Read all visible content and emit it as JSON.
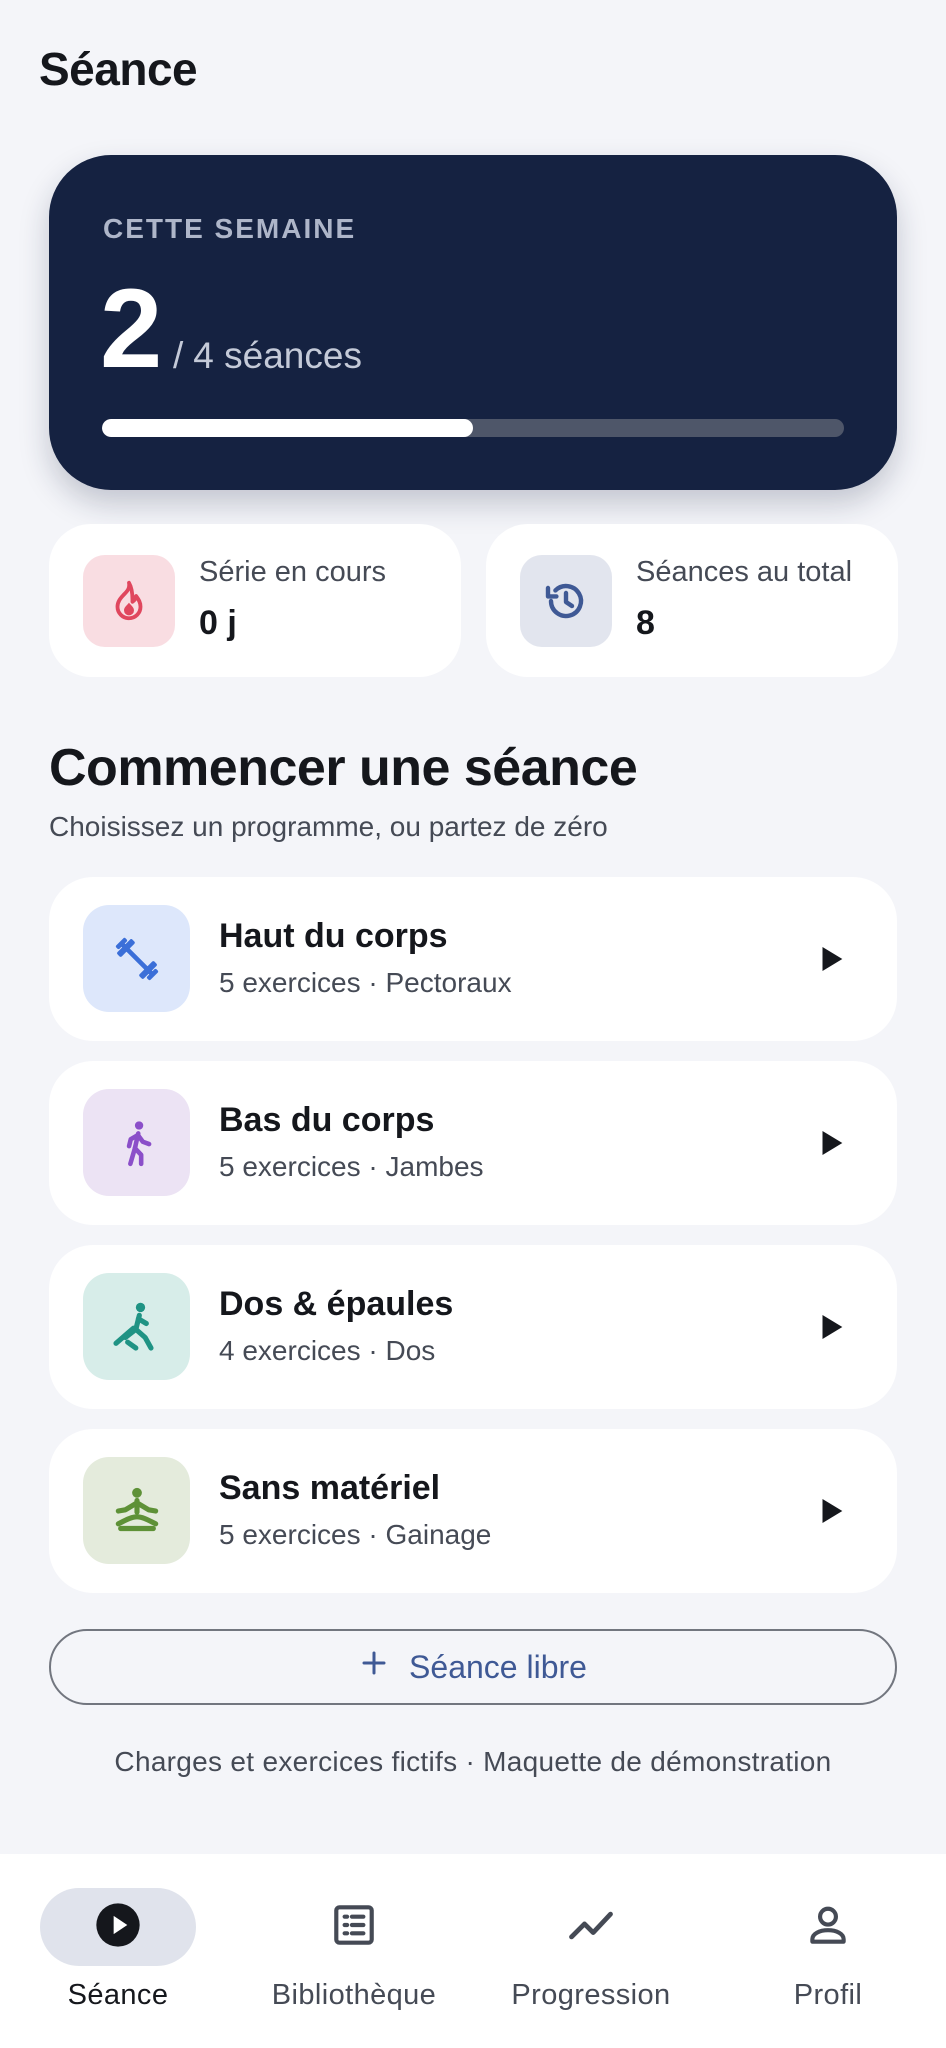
{
  "header": {
    "title": "Séance"
  },
  "week": {
    "eyebrow": "CETTE SEMAINE",
    "done": "2",
    "slash": "/",
    "target": "4 séances",
    "progress": 0.5
  },
  "stats": [
    {
      "label": "Série en cours",
      "value": "0 j",
      "icon": "flame-icon",
      "color": "#e0475e"
    },
    {
      "label": "Séances au total",
      "value": "8",
      "icon": "history-icon",
      "color": "#3f5995"
    }
  ],
  "section": {
    "title": "Commencer une séance",
    "subtitle": "Choisissez un programme, ou partez de zéro"
  },
  "programs": [
    {
      "title": "Haut du corps",
      "meta": "5 exercices · Pectoraux",
      "icon": "dumbbell-icon",
      "tint": "#dde7fb",
      "color": "#3b6fd8"
    },
    {
      "title": "Bas du corps",
      "meta": "5 exercices · Jambes",
      "icon": "walking-icon",
      "tint": "#ece3f4",
      "color": "#8b4fc9"
    },
    {
      "title": "Dos & épaules",
      "meta": "4 exercices · Dos",
      "icon": "rowing-icon",
      "tint": "#d7ede9",
      "color": "#1f9384"
    },
    {
      "title": "Sans matériel",
      "meta": "5 exercices · Gainage",
      "icon": "meditation-icon",
      "tint": "#e4ebdc",
      "color": "#5e9137"
    }
  ],
  "free_session": {
    "label": "Séance libre"
  },
  "footnote": "Charges et exercices fictifs · Maquette de démonstration",
  "nav": [
    {
      "label": "Séance",
      "icon": "play-circle-icon",
      "active": true
    },
    {
      "label": "Bibliothèque",
      "icon": "list-icon",
      "active": false
    },
    {
      "label": "Progression",
      "icon": "trend-icon",
      "active": false
    },
    {
      "label": "Profil",
      "icon": "person-icon",
      "active": false
    }
  ]
}
